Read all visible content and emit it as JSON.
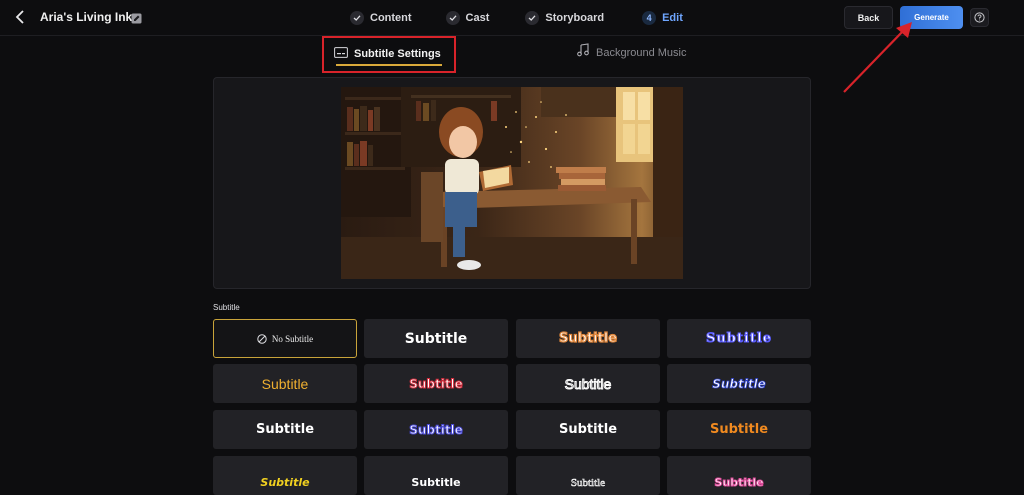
{
  "header": {
    "project_title": "Aria's Living Ink",
    "steps": [
      {
        "label": "Content",
        "state": "done"
      },
      {
        "label": "Cast",
        "state": "done"
      },
      {
        "label": "Storyboard",
        "state": "done"
      },
      {
        "label": "Edit",
        "state": "active",
        "number": "4"
      }
    ],
    "back_label": "Back",
    "generate_label": "Generate"
  },
  "tabs": {
    "subtitle_settings": "Subtitle Settings",
    "background_music": "Background Music"
  },
  "preview": {
    "description_icon": "storybook-illustration"
  },
  "subtitle_section": {
    "label": "Subtitle",
    "none_label": "No Subtitle",
    "style_text": "Subtitle"
  },
  "colors": {
    "accent": "#4e8ff0",
    "selected_border": "#c9a43a",
    "annotation_red": "#d8232a"
  }
}
